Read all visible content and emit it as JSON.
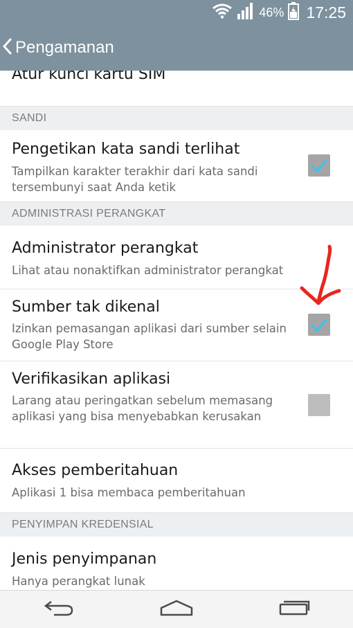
{
  "status_bar": {
    "battery_percent": "46%",
    "time": "17:25"
  },
  "action_bar": {
    "title": "Pengamanan",
    "back_icon": "chevron-left-icon"
  },
  "partial_item": {
    "title": "Atur kunci kartu SIM"
  },
  "sections": {
    "sandi": "SANDI",
    "admin": "ADMINISTRASI PERANGKAT",
    "credential": "PENYIMPAN KREDENSIAL"
  },
  "items": {
    "password_visible": {
      "title": "Pengetikan kata sandi terlihat",
      "summary": "Tampilkan karakter terakhir dari kata sandi tersembunyi saat Anda ketik",
      "checked": true
    },
    "device_admin": {
      "title": "Administrator perangkat",
      "summary": "Lihat atau nonaktifkan administrator perangkat"
    },
    "unknown_sources": {
      "title": "Sumber tak dikenal",
      "summary": "Izinkan pemasangan aplikasi dari sumber selain Google Play Store",
      "checked": true
    },
    "verify_apps": {
      "title": "Verifikasikan aplikasi",
      "summary": "Larang atau peringatkan sebelum memasang aplikasi yang bisa menyebabkan kerusakan",
      "checked": false
    },
    "notification_access": {
      "title": "Akses pemberitahuan",
      "summary": "Aplikasi 1 bisa membaca pemberitahuan"
    },
    "storage_type": {
      "title": "Jenis penyimpanan",
      "summary": "Hanya perangkat lunak"
    }
  },
  "colors": {
    "action_bar": "#7e919e",
    "checkmark": "#33c6f0",
    "annotation": "#e8261f"
  },
  "nav_bar": {
    "back_icon": "back-arrow-icon",
    "home_icon": "home-icon",
    "recents_icon": "recents-icon"
  }
}
